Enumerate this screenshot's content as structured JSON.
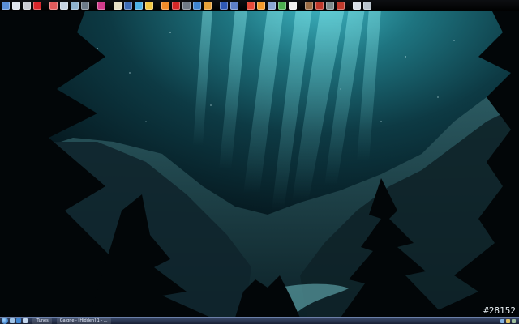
{
  "toolbar": {
    "icons": [
      {
        "name": "computer-icon",
        "color": "#5a8fd6"
      },
      {
        "name": "document-icon",
        "color": "#dfe6ee"
      },
      {
        "name": "disc-icon",
        "color": "#c9ccd2"
      },
      {
        "name": "acrobat-icon",
        "color": "#d8262b"
      },
      {
        "name": "sep"
      },
      {
        "name": "pdf-icon",
        "color": "#e25b5b"
      },
      {
        "name": "image-icon",
        "color": "#c7d4e3"
      },
      {
        "name": "photo-icon",
        "color": "#8fb3cf"
      },
      {
        "name": "camera-icon",
        "color": "#6c7a88"
      },
      {
        "name": "sep"
      },
      {
        "name": "media-icon",
        "color": "#d33b8c"
      },
      {
        "name": "sep"
      },
      {
        "name": "notes-icon",
        "color": "#e6e0c6"
      },
      {
        "name": "tools-icon",
        "color": "#3e6cb8"
      },
      {
        "name": "settings-icon",
        "color": "#4fb3e6"
      },
      {
        "name": "help-icon",
        "color": "#f2c744"
      },
      {
        "name": "sep"
      },
      {
        "name": "chrome-icon",
        "color": "#f08b2a"
      },
      {
        "name": "opera-icon",
        "color": "#d52727"
      },
      {
        "name": "browser-icon",
        "color": "#6f7a86"
      },
      {
        "name": "globe-icon",
        "color": "#3f85d1"
      },
      {
        "name": "orb-icon",
        "color": "#e8a23a"
      },
      {
        "name": "sep"
      },
      {
        "name": "network-icon",
        "color": "#2e58b5"
      },
      {
        "name": "stats-icon",
        "color": "#5d7fc9"
      },
      {
        "name": "sep"
      },
      {
        "name": "office-icon",
        "color": "#e84a3a"
      },
      {
        "name": "firefox-icon",
        "color": "#f39a2b"
      },
      {
        "name": "search-icon",
        "color": "#8aa6d3"
      },
      {
        "name": "eye-icon",
        "color": "#4caf50"
      },
      {
        "name": "window-icon",
        "color": "#eeeeee"
      },
      {
        "name": "sep"
      },
      {
        "name": "game-icon",
        "color": "#9c6d45"
      },
      {
        "name": "car-icon",
        "color": "#c0392b"
      },
      {
        "name": "tank-icon",
        "color": "#7f8c8d"
      },
      {
        "name": "star-icon",
        "color": "#c0392b"
      },
      {
        "name": "sep"
      },
      {
        "name": "steam-icon",
        "color": "#d8dee6"
      },
      {
        "name": "folder-icon",
        "color": "#b9c3cc"
      }
    ]
  },
  "taskbar": {
    "quick_launch": [
      {
        "name": "show-desktop-icon",
        "color": "#9fc4e8"
      },
      {
        "name": "browser-quick-icon",
        "color": "#3f85d1"
      },
      {
        "name": "itunes-quick-icon",
        "color": "#c3d7ef"
      }
    ],
    "tasks": [
      {
        "label": "iTunes"
      },
      {
        "label": "Gaigne - [Hidden] 1 - ..."
      }
    ],
    "tray_colors": [
      "#7fb0e0",
      "#e0c060",
      "#a0c0a0"
    ]
  },
  "watermark": "#28152"
}
